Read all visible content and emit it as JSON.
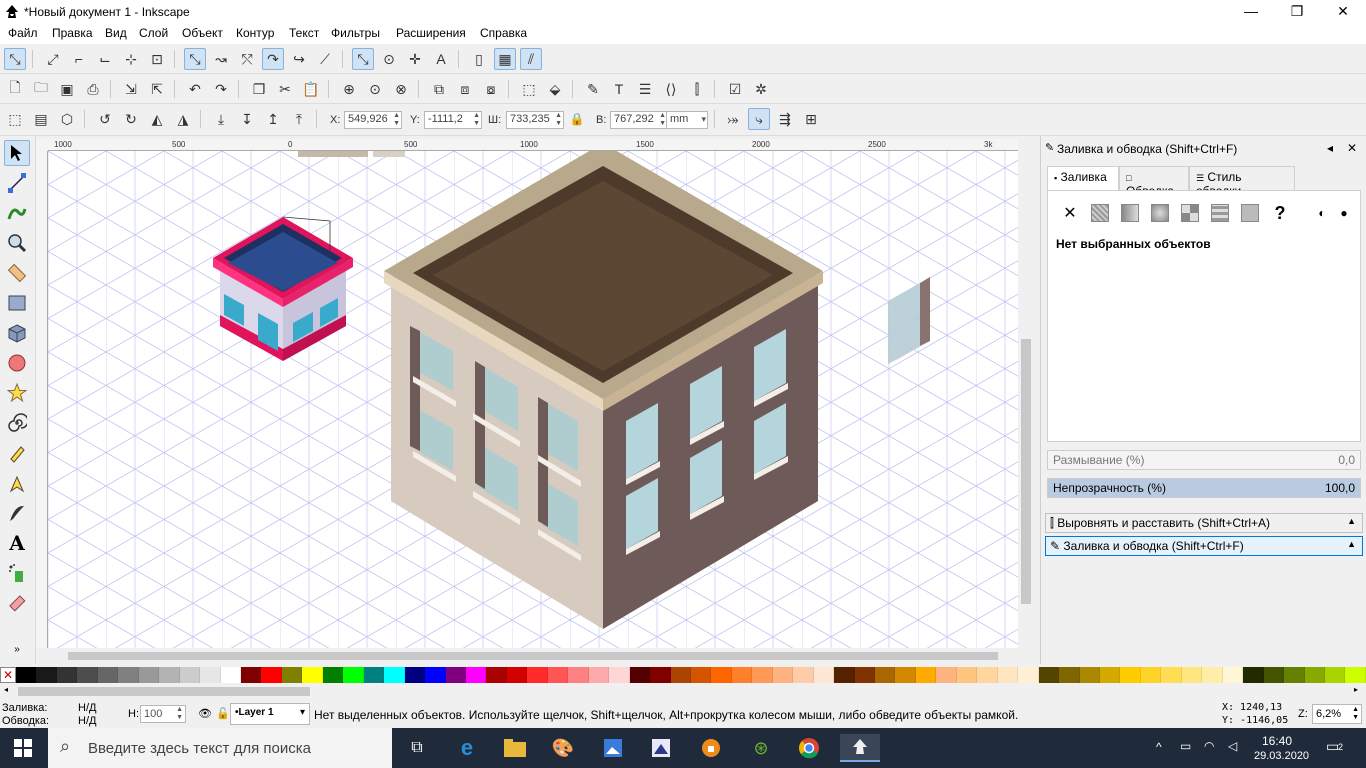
{
  "window": {
    "title": "*Новый документ 1 - Inkscape",
    "min": "—",
    "max": "❐",
    "close": "✕"
  },
  "menu": [
    "Файл",
    "Правка",
    "Вид",
    "Слой",
    "Объект",
    "Контур",
    "Текст",
    "Фильтры",
    "Расширения",
    "Справка"
  ],
  "toolcontrols": {
    "x_label": "X:",
    "x_value": "549,926",
    "y_label": "Y:",
    "y_value": "-1111,2",
    "w_label": "Ш:",
    "w_value": "733,235",
    "h_label": "В:",
    "h_value": "767,292",
    "unit": "mm"
  },
  "ruler": {
    "top_ticks": [
      "1000",
      "500",
      "0",
      "500",
      "1000",
      "1500",
      "2000",
      "2500",
      "3k"
    ]
  },
  "dock": {
    "title": "Заливка и обводка (Shift+Ctrl+F)",
    "tabs": [
      "Заливка",
      "Обводка",
      "Стиль обводки"
    ],
    "no_selection": "Нет выбранных объектов",
    "blur_label": "Размывание (%)",
    "blur_value": "0,0",
    "blur_fraction": 0,
    "opacity_label": "Непрозрачность (%)",
    "opacity_value": "100,0",
    "opacity_fraction": 1,
    "collapsed1": "Выровнять и расставить (Shift+Ctrl+A)",
    "collapsed2": "Заливка и обводка (Shift+Ctrl+F)",
    "unknown_glyph": "?"
  },
  "palette_colors": [
    "#000000",
    "#1a1a1a",
    "#333333",
    "#4d4d4d",
    "#666666",
    "#808080",
    "#999999",
    "#b3b3b3",
    "#cccccc",
    "#e6e6e6",
    "#ffffff",
    "#800000",
    "#ff0000",
    "#808000",
    "#ffff00",
    "#008000",
    "#00ff00",
    "#008080",
    "#00ffff",
    "#000080",
    "#0000ff",
    "#800080",
    "#ff00ff",
    "#aa0000",
    "#d40000",
    "#ff2a2a",
    "#ff5555",
    "#ff8080",
    "#ffaaaa",
    "#ffd5d5",
    "#550000",
    "#800000",
    "#aa4400",
    "#d45500",
    "#ff6600",
    "#ff7f2a",
    "#ff9955",
    "#ffb380",
    "#ffccaa",
    "#ffe6d5",
    "#552200",
    "#803300",
    "#aa6600",
    "#d48800",
    "#ffaa00",
    "#ffb380",
    "#ffc680",
    "#ffd5a0",
    "#ffe6c0",
    "#fff0d5",
    "#554400",
    "#806600",
    "#aa8800",
    "#d4aa00",
    "#ffcc00",
    "#ffd42a",
    "#ffdd55",
    "#ffe680",
    "#ffeeaa",
    "#fff6d5",
    "#222b00",
    "#445500",
    "#668000",
    "#88aa00",
    "#aad400",
    "#ccff00"
  ],
  "status": {
    "fill_label": "Заливка:",
    "fill_value": "Н/Д",
    "stroke_label": "Обводка:",
    "stroke_value": "Н/Д",
    "h_label": "Н:",
    "h_value": "100",
    "layer": "•Layer 1",
    "message": "Нет выделенных объектов. Используйте щелчок, Shift+щелчок, Alt+прокрутка колесом мыши, либо обведите объекты рамкой.",
    "x_coord": "X: 1240,13",
    "y_coord": "Y: -1146,05",
    "zoom_label": "Z:",
    "zoom_value": "6,2%"
  },
  "taskbar": {
    "search_placeholder": "Введите здесь текст для поиска",
    "time": "16:40",
    "date": "29.03.2020",
    "notif_count": "2"
  }
}
